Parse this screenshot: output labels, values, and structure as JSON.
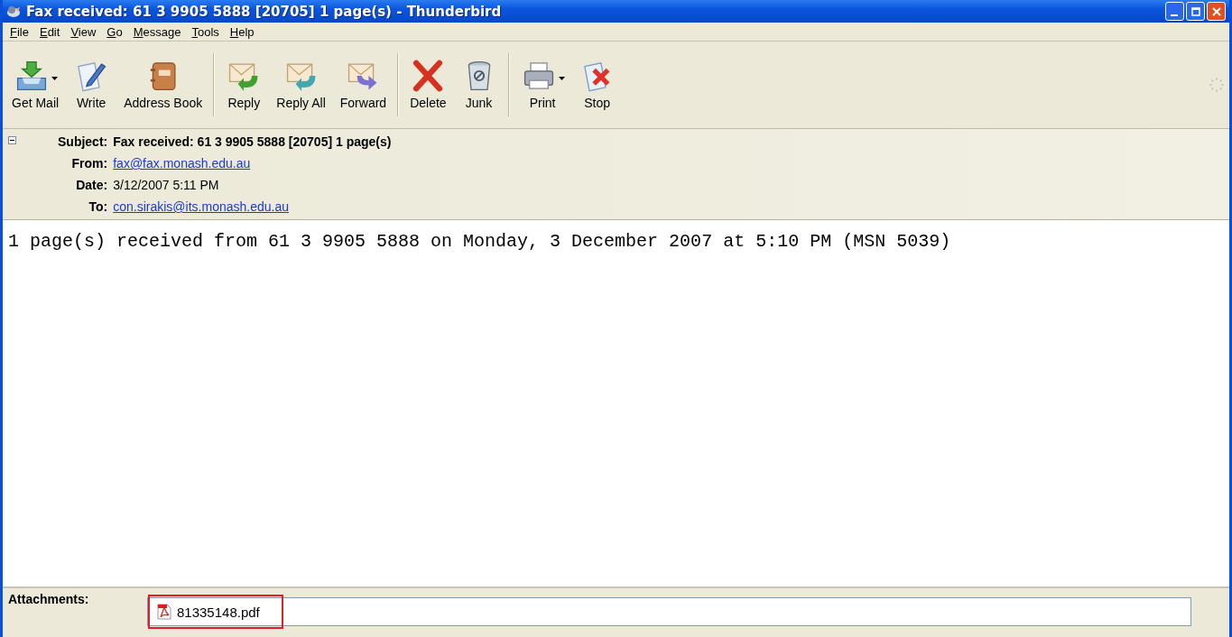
{
  "window": {
    "title": "Fax received: 61 3 9905 5888 [20705] 1 page(s) - Thunderbird"
  },
  "menu": [
    {
      "label": "File"
    },
    {
      "label": "Edit"
    },
    {
      "label": "View"
    },
    {
      "label": "Go"
    },
    {
      "label": "Message"
    },
    {
      "label": "Tools"
    },
    {
      "label": "Help"
    }
  ],
  "toolbar": [
    [
      {
        "label": "Get Mail",
        "kind": "getmail",
        "dropdown": true
      },
      {
        "label": "Write",
        "kind": "write",
        "dropdown": false
      },
      {
        "label": "Address Book",
        "kind": "book",
        "dropdown": false
      }
    ],
    [
      {
        "label": "Reply",
        "kind": "reply",
        "dropdown": false
      },
      {
        "label": "Reply All",
        "kind": "replyall",
        "dropdown": false
      },
      {
        "label": "Forward",
        "kind": "forward",
        "dropdown": false
      }
    ],
    [
      {
        "label": "Delete",
        "kind": "delete",
        "dropdown": false
      },
      {
        "label": "Junk",
        "kind": "junk",
        "dropdown": false
      }
    ],
    [
      {
        "label": "Print",
        "kind": "print",
        "dropdown": true
      },
      {
        "label": "Stop",
        "kind": "stop",
        "dropdown": false
      }
    ]
  ],
  "header": {
    "expanded": true,
    "fields": [
      {
        "label": "Subject:",
        "value": "Fax received: 61 3 9905 5888 [20705] 1 page(s)",
        "kind": "bold"
      },
      {
        "label": "From:",
        "value": "fax@fax.monash.edu.au",
        "kind": "link"
      },
      {
        "label": "Date:",
        "value": "3/12/2007 5:11 PM",
        "kind": "plain"
      },
      {
        "label": "To:",
        "value": "con.sirakis@its.monash.edu.au",
        "kind": "link"
      }
    ]
  },
  "body": "1 page(s) received from 61 3 9905 5888 on Monday, 3 December 2007 at 5:10 PM (MSN 5039)",
  "attachments": {
    "label": "Attachments:",
    "items": [
      {
        "name": "81335148.pdf",
        "highlighted": true
      }
    ]
  }
}
